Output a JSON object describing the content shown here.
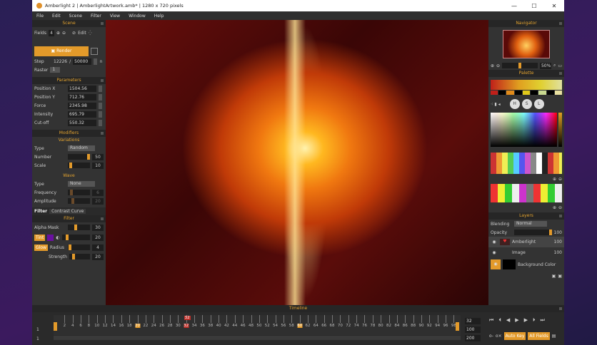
{
  "window": {
    "title": "Amberlight 2 | AmberlightArtwork.amb* | 1280 x 720 pixels",
    "minimize": "—",
    "maximize": "☐",
    "close": "✕"
  },
  "menu": [
    "File",
    "Edit",
    "Scene",
    "Filter",
    "View",
    "Window",
    "Help"
  ],
  "scene": {
    "header": "Scene",
    "fields_label": "Fields",
    "fields_value": "4",
    "edit_label": "Edit",
    "render_label": "Render",
    "step_label": "Step",
    "step_value": "12226",
    "step_sep": "/",
    "step_max": "50000",
    "raster_label": "Raster",
    "raster_value": "1"
  },
  "parameters": {
    "header": "Parameters",
    "items": [
      {
        "label": "Position X",
        "value": "1504.56"
      },
      {
        "label": "Position Y",
        "value": "712.76"
      },
      {
        "label": "Force",
        "value": "2345.98"
      },
      {
        "label": "Intensity",
        "value": "695.79"
      },
      {
        "label": "Cut-off",
        "value": "550.32"
      }
    ]
  },
  "modifiers": {
    "header": "Modifiers",
    "variations": {
      "title": "Variations",
      "type_label": "Type",
      "type_value": "Random",
      "number_label": "Number",
      "number_value": "50",
      "number_fraction": 0.95,
      "scale_label": "Scale",
      "scale_value": "10",
      "scale_fraction": 0.08
    },
    "wave": {
      "title": "Wave",
      "type_label": "Type",
      "type_value": "None",
      "frequency_label": "Frequency",
      "frequency_value": "6",
      "frequency_fraction": 0.1,
      "amplitude_label": "Amplitude",
      "amplitude_value": "20",
      "amplitude_fraction": 0.18
    }
  },
  "filter": {
    "tabs": [
      "Filter",
      "Contrast Curve"
    ],
    "header": "Filter",
    "alpha_label": "Alpha Mask",
    "alpha_value": "30",
    "alpha_fraction": 0.3,
    "tint_label": "Tint",
    "tint_value": "20",
    "tint_color": "#6a10a0",
    "glow_label": "Glow",
    "radius_label": "Radius",
    "radius_value": "4",
    "strength_label": "Strength",
    "strength_value": "20"
  },
  "navigator": {
    "header": "Navigator",
    "zoom": "50%"
  },
  "palette": {
    "header": "Palette",
    "swatches": [
      "#c0201a",
      "#000000",
      "#e08a1a",
      "#000000",
      "#e0c81a",
      "#000000",
      "#c8d890",
      "#000000",
      "#e8e0a0"
    ],
    "h": "H",
    "s": "S",
    "l": "L"
  },
  "layers": {
    "header": "Layers",
    "blending_label": "Blending",
    "blending_value": "Normal",
    "opacity_label": "Opacity",
    "opacity_value": "100",
    "items": [
      {
        "name": "Amberlight",
        "value": "100"
      },
      {
        "name": "Image",
        "value": "100"
      },
      {
        "name": "Background Color",
        "value": ""
      }
    ]
  },
  "timeline": {
    "header": "Timeline",
    "ticks": [
      "2",
      "4",
      "6",
      "8",
      "10",
      "12",
      "14",
      "16",
      "18",
      "20",
      "22",
      "24",
      "26",
      "28",
      "30",
      "32",
      "34",
      "36",
      "38",
      "40",
      "42",
      "44",
      "46",
      "48",
      "50",
      "52",
      "54",
      "56",
      "58",
      "60",
      "62",
      "64",
      "66",
      "68",
      "70",
      "72",
      "74",
      "76",
      "78",
      "80",
      "82",
      "84",
      "86",
      "88",
      "90",
      "92",
      "94",
      "96",
      "98"
    ],
    "current_frame": "32",
    "row1": "1",
    "row2": "1",
    "current_value": "32",
    "end_value": "100",
    "max_value": "200",
    "auto_key": "Auto Key",
    "all_fields": "All Fields"
  }
}
